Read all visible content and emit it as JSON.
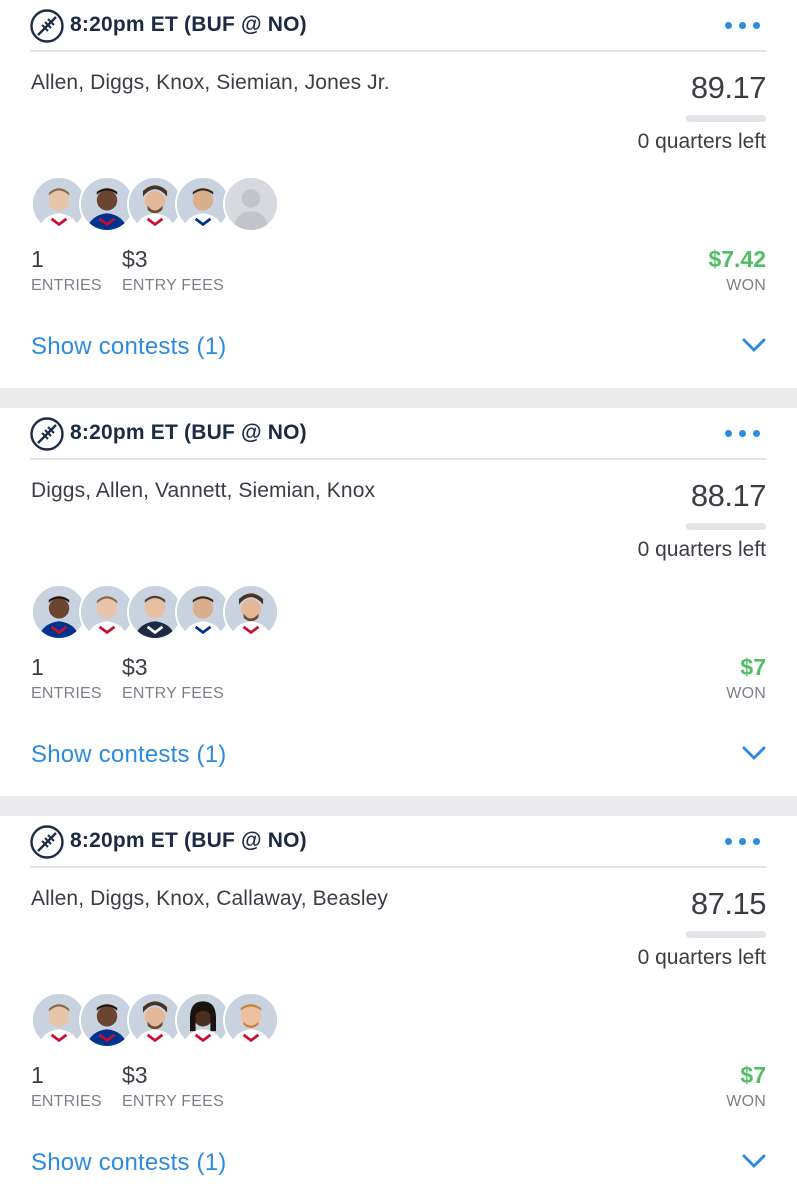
{
  "colors": {
    "accent": "#2c8be0",
    "won": "#4fbf63",
    "title": "#1c2a44",
    "divider": "#e3e4e8",
    "separator": "#ececef"
  },
  "entries": [
    {
      "sport_icon": "football-icon",
      "game_time": "8:20pm ET (BUF @ NO)",
      "more_icon": "more-dots-icon",
      "players": "Allen, Diggs, Knox, Siemian, Jones Jr.",
      "score": "89.17",
      "progress_percent": 0,
      "quarters_left": "0 quarters left",
      "avatars": [
        "avatar-photo",
        "avatar-photo",
        "avatar-photo",
        "avatar-photo",
        "avatar-placeholder"
      ],
      "entries_value": "1",
      "entries_label": "ENTRIES",
      "fees_value": "$3",
      "fees_label": "ENTRY FEES",
      "won_value": "$7.42",
      "won_label": "WON",
      "show_contests": "Show contests (1)",
      "chevron_icon": "chevron-down-icon"
    },
    {
      "sport_icon": "football-icon",
      "game_time": "8:20pm ET (BUF @ NO)",
      "more_icon": "more-dots-icon",
      "players": "Diggs, Allen, Vannett, Siemian, Knox",
      "score": "88.17",
      "progress_percent": 0,
      "quarters_left": "0 quarters left",
      "avatars": [
        "avatar-photo",
        "avatar-photo",
        "avatar-photo",
        "avatar-photo",
        "avatar-photo"
      ],
      "entries_value": "1",
      "entries_label": "ENTRIES",
      "fees_value": "$3",
      "fees_label": "ENTRY FEES",
      "won_value": "$7",
      "won_label": "WON",
      "show_contests": "Show contests (1)",
      "chevron_icon": "chevron-down-icon"
    },
    {
      "sport_icon": "football-icon",
      "game_time": "8:20pm ET (BUF @ NO)",
      "more_icon": "more-dots-icon",
      "players": "Allen, Diggs, Knox, Callaway, Beasley",
      "score": "87.15",
      "progress_percent": 0,
      "quarters_left": "0 quarters left",
      "avatars": [
        "avatar-photo",
        "avatar-photo",
        "avatar-photo",
        "avatar-photo",
        "avatar-photo"
      ],
      "entries_value": "1",
      "entries_label": "ENTRIES",
      "fees_value": "$3",
      "fees_label": "ENTRY FEES",
      "won_value": "$7",
      "won_label": "WON",
      "show_contests": "Show contests (1)",
      "chevron_icon": "chevron-down-icon"
    }
  ]
}
